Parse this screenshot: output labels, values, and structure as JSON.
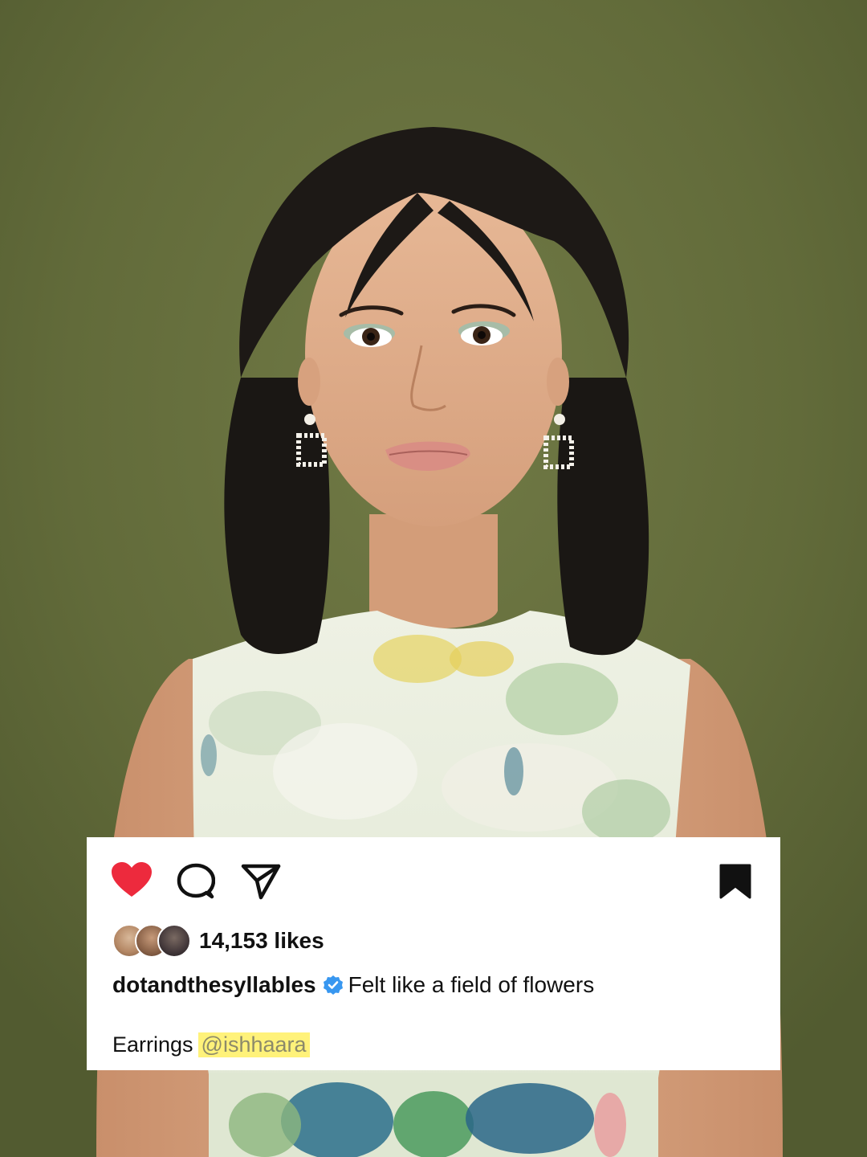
{
  "colors": {
    "backdrop": "#646d3c",
    "card_background": "#ffffff",
    "like_active": "#ed2a3d",
    "verified": "#3897f0",
    "mention_highlight": "#fff27a",
    "mention_text": "#8c8a6a"
  },
  "photo": {
    "alt": "portrait photo"
  },
  "post": {
    "actions": {
      "like_icon": "heart-filled-icon",
      "comment_icon": "comment-bubble-icon",
      "share_icon": "paper-plane-icon",
      "save_icon": "bookmark-filled-icon"
    },
    "likes_text": "14,153 likes",
    "username": "dotandthesyllables",
    "verified": true,
    "caption": "Felt like a field of flowers",
    "credit_label": "Earrings",
    "mention": "@ishhaara"
  }
}
